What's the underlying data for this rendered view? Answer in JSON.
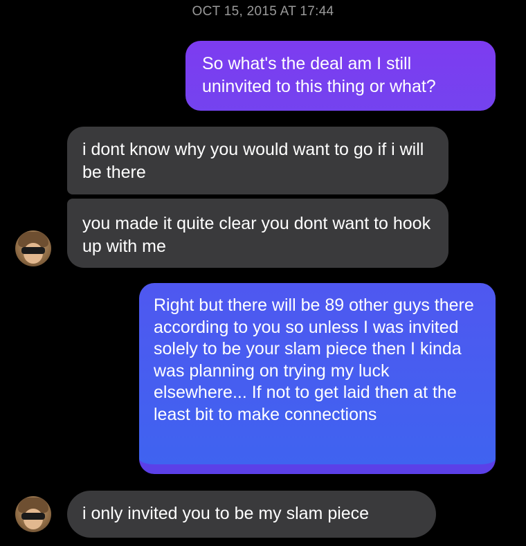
{
  "conversation": {
    "timestamp": "OCT 15, 2015 AT 17:44",
    "messages": [
      {
        "direction": "outgoing",
        "text": "So what's the deal am I still uninvited to this thing or what?"
      },
      {
        "direction": "incoming",
        "text": "i dont know why you would want to go if i will be there"
      },
      {
        "direction": "incoming",
        "text": "you made it quite clear you dont want to hook up with me"
      },
      {
        "direction": "outgoing",
        "text": "Right but there will be 89 other guys there according to you so unless I was invited solely to be your slam piece then I kinda was planning on trying my luck elsewhere... If not to get laid then at the least bit to make connections"
      },
      {
        "direction": "incoming",
        "text": "i only invited you to be my slam piece"
      }
    ],
    "colors": {
      "background": "#000000",
      "outgoing_purple": "#7a3ff0",
      "outgoing_blue": "#4a5ef0",
      "incoming_gray": "#3a3a3c",
      "timestamp_gray": "#9a9a9a"
    },
    "avatar_icon": "user-avatar-icon"
  }
}
